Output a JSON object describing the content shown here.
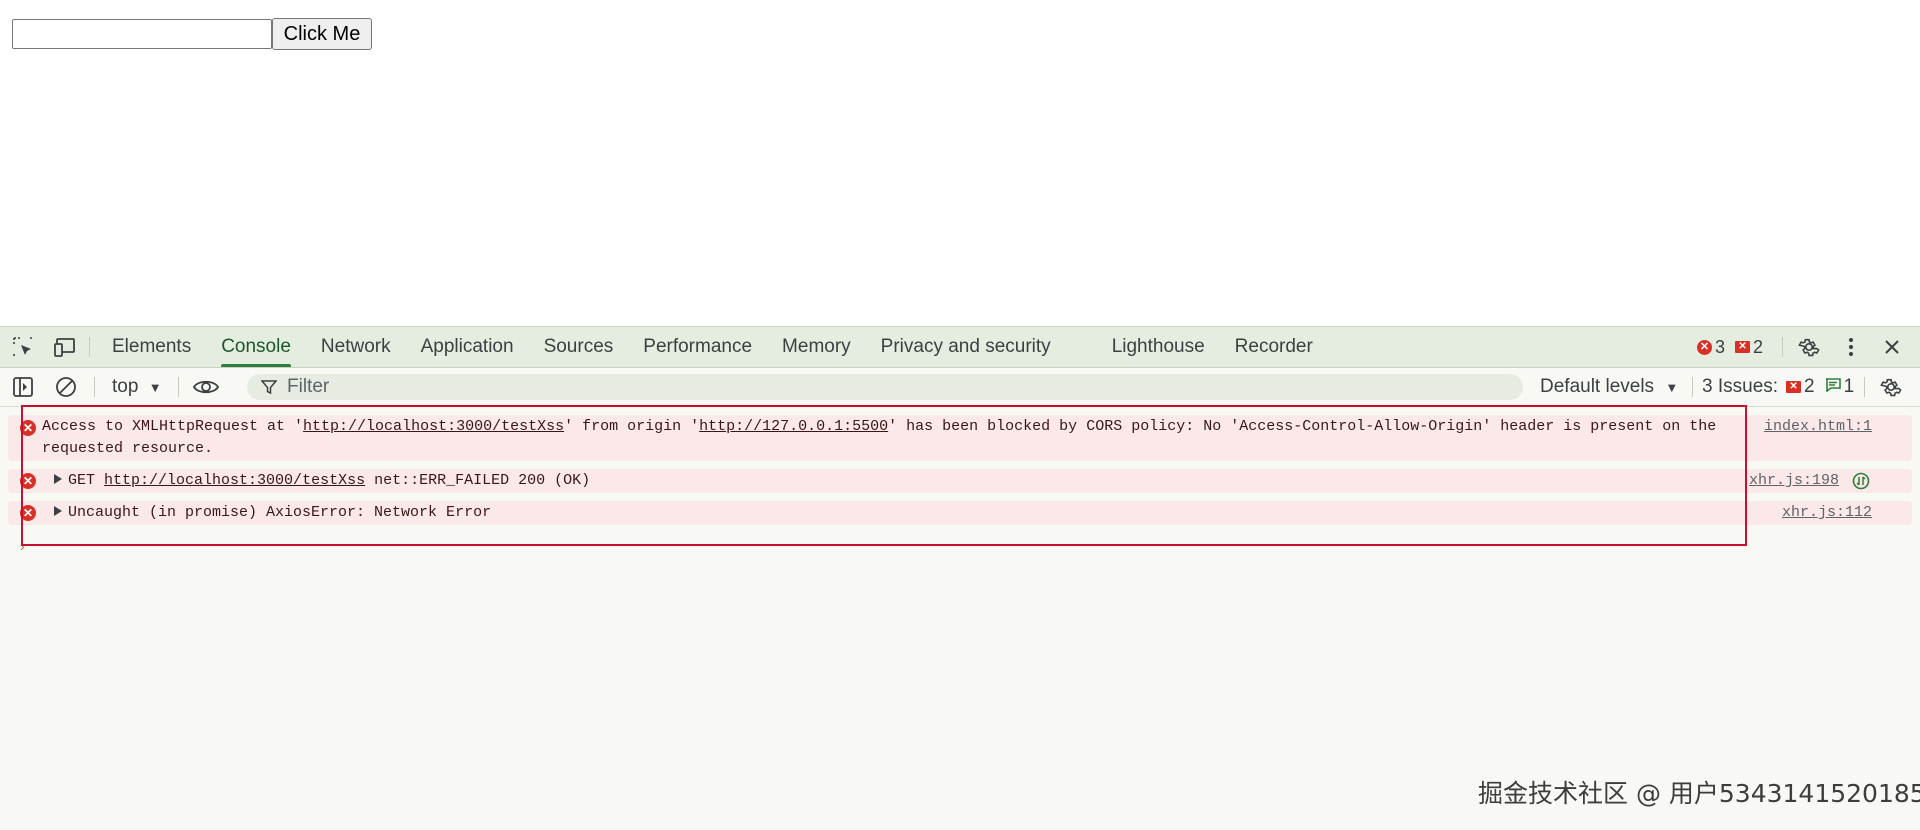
{
  "page": {
    "input_value": "",
    "button_label": "Click Me"
  },
  "devtools": {
    "tabs": [
      {
        "label": "Elements"
      },
      {
        "label": "Console"
      },
      {
        "label": "Network"
      },
      {
        "label": "Application"
      },
      {
        "label": "Sources"
      },
      {
        "label": "Performance"
      },
      {
        "label": "Memory"
      },
      {
        "label": "Privacy and security"
      },
      {
        "label": "Lighthouse"
      },
      {
        "label": "Recorder"
      }
    ],
    "active_tab": "Console",
    "error_count": "3",
    "warning_count": "2",
    "toolbar": {
      "context": "top",
      "filter_placeholder": "Filter",
      "levels": "Default levels",
      "issues_label": "3 Issues:",
      "issues_errors": "2",
      "issues_info": "1"
    },
    "messages": [
      {
        "prefix": "Access to XMLHttpRequest at '",
        "url1": "http://localhost:3000/testXss",
        "mid": "' from origin '",
        "url2": "http://127.0.0.1:5500",
        "suffix": "' has been blocked by CORS policy: No 'Access-Control-Allow-Origin' header is present on the",
        "line2": "requested resource.",
        "source": "index.html:1"
      },
      {
        "method": "GET",
        "url": "http://localhost:3000/testXss",
        "suffix": "net::ERR_FAILED 200 (OK)",
        "source": "xhr.js:198"
      },
      {
        "text": "Uncaught (in promise) AxiosError: Network Error",
        "source": "xhr.js:112"
      }
    ]
  },
  "watermark": "掘金技术社区 @ 用户5343141520185",
  "colors": {
    "error_red": "#d93025",
    "error_bg": "#fbe9e9",
    "tabbar_bg": "#e5ede0",
    "highlight_border": "#c8102e"
  }
}
